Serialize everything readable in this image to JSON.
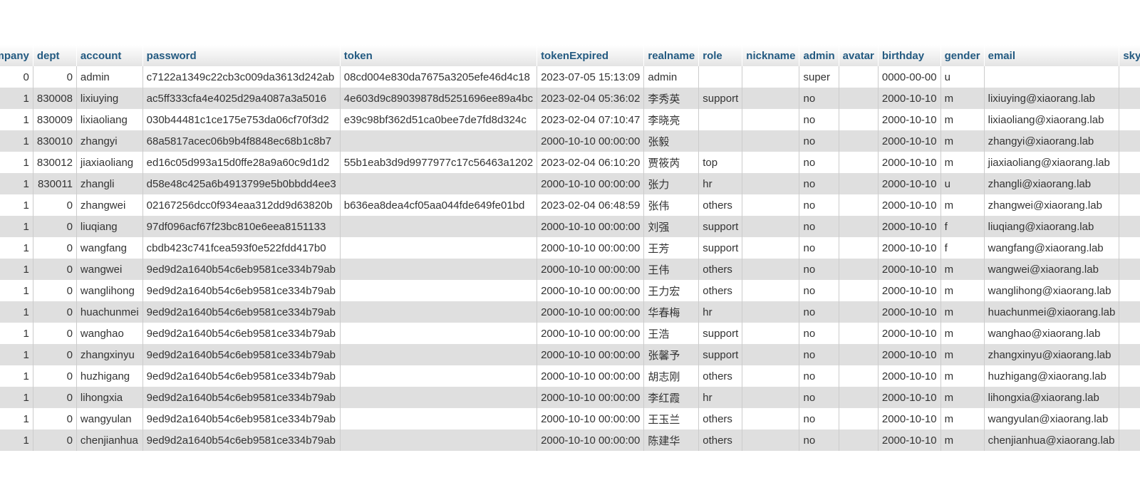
{
  "table": {
    "columns": [
      "company",
      "dept",
      "account",
      "password",
      "token",
      "tokenExpired",
      "realname",
      "role",
      "nickname",
      "admin",
      "avatar",
      "birthday",
      "gender",
      "email",
      "skype"
    ],
    "header_labels": {
      "company": "company",
      "dept": "dept",
      "account": "account",
      "password": "password",
      "token": "token",
      "tokenExpired": "tokenExpired",
      "realname": "realname",
      "role": "role",
      "nickname": "nickname",
      "admin": "admin",
      "avatar": "avatar",
      "birthday": "birthday",
      "gender": "gender",
      "email": "email",
      "skype": "skype"
    },
    "rows": [
      [
        "0",
        "0",
        "admin",
        "c7122a1349c22cb3c009da3613d242ab",
        "08cd004e830da7675a3205efe46d4c18",
        "2023-07-05 15:13:09",
        "admin",
        "",
        "",
        "super",
        "",
        "0000-00-00",
        "u",
        "",
        ""
      ],
      [
        "1",
        "830008",
        "lixiuying",
        "ac5ff333cfa4e4025d29a4087a3a5016",
        "4e603d9c89039878d5251696ee89a4bc",
        "2023-02-04 05:36:02",
        "李秀英",
        "support",
        "",
        "no",
        "",
        "2000-10-10",
        "m",
        "lixiuying@xiaorang.lab",
        ""
      ],
      [
        "1",
        "830009",
        "lixiaoliang",
        "030b44481c1ce175e753da06cf70f3d2",
        "e39c98bf362d51ca0bee7de7fd8d324c",
        "2023-02-04 07:10:47",
        "李晓亮",
        "",
        "",
        "no",
        "",
        "2000-10-10",
        "m",
        "lixiaoliang@xiaorang.lab",
        ""
      ],
      [
        "1",
        "830010",
        "zhangyi",
        "68a5817acec06b9b4f8848ec68b1c8b7",
        "",
        "2000-10-10 00:00:00",
        "张毅",
        "",
        "",
        "no",
        "",
        "2000-10-10",
        "m",
        "zhangyi@xiaorang.lab",
        ""
      ],
      [
        "1",
        "830012",
        "jiaxiaoliang",
        "ed16c05d993a15d0ffe28a9a60c9d1d2",
        "55b1eab3d9d9977977c17c56463a1202",
        "2023-02-04 06:10:20",
        "贾筱芮",
        "top",
        "",
        "no",
        "",
        "2000-10-10",
        "m",
        "jiaxiaoliang@xiaorang.lab",
        ""
      ],
      [
        "1",
        "830011",
        "zhangli",
        "d58e48c425a6b4913799e5b0bbdd4ee3",
        "",
        "2000-10-10 00:00:00",
        "张力",
        "hr",
        "",
        "no",
        "",
        "2000-10-10",
        "u",
        "zhangli@xiaorang.lab",
        ""
      ],
      [
        "1",
        "0",
        "zhangwei",
        "02167256dcc0f934eaa312dd9d63820b",
        "b636ea8dea4cf05aa044fde649fe01bd",
        "2023-02-04 06:48:59",
        "张伟",
        "others",
        "",
        "no",
        "",
        "2000-10-10",
        "m",
        "zhangwei@xiaorang.lab",
        ""
      ],
      [
        "1",
        "0",
        "liuqiang",
        "97df096acf67f23bc810e6eea8151133",
        "",
        "2000-10-10 00:00:00",
        "刘强",
        "support",
        "",
        "no",
        "",
        "2000-10-10",
        "f",
        "liuqiang@xiaorang.lab",
        ""
      ],
      [
        "1",
        "0",
        "wangfang",
        "cbdb423c741fcea593f0e522fdd417b0",
        "",
        "2000-10-10 00:00:00",
        "王芳",
        "support",
        "",
        "no",
        "",
        "2000-10-10",
        "f",
        "wangfang@xiaorang.lab",
        ""
      ],
      [
        "1",
        "0",
        "wangwei",
        "9ed9d2a1640b54c6eb9581ce334b79ab",
        "",
        "2000-10-10 00:00:00",
        "王伟",
        "others",
        "",
        "no",
        "",
        "2000-10-10",
        "m",
        "wangwei@xiaorang.lab",
        ""
      ],
      [
        "1",
        "0",
        "wanglihong",
        "9ed9d2a1640b54c6eb9581ce334b79ab",
        "",
        "2000-10-10 00:00:00",
        "王力宏",
        "others",
        "",
        "no",
        "",
        "2000-10-10",
        "m",
        "wanglihong@xiaorang.lab",
        ""
      ],
      [
        "1",
        "0",
        "huachunmei",
        "9ed9d2a1640b54c6eb9581ce334b79ab",
        "",
        "2000-10-10 00:00:00",
        "华春梅",
        "hr",
        "",
        "no",
        "",
        "2000-10-10",
        "m",
        "huachunmei@xiaorang.lab",
        ""
      ],
      [
        "1",
        "0",
        "wanghao",
        "9ed9d2a1640b54c6eb9581ce334b79ab",
        "",
        "2000-10-10 00:00:00",
        "王浩",
        "support",
        "",
        "no",
        "",
        "2000-10-10",
        "m",
        "wanghao@xiaorang.lab",
        ""
      ],
      [
        "1",
        "0",
        "zhangxinyu",
        "9ed9d2a1640b54c6eb9581ce334b79ab",
        "",
        "2000-10-10 00:00:00",
        "张馨予",
        "support",
        "",
        "no",
        "",
        "2000-10-10",
        "m",
        "zhangxinyu@xiaorang.lab",
        ""
      ],
      [
        "1",
        "0",
        "huzhigang",
        "9ed9d2a1640b54c6eb9581ce334b79ab",
        "",
        "2000-10-10 00:00:00",
        "胡志刚",
        "others",
        "",
        "no",
        "",
        "2000-10-10",
        "m",
        "huzhigang@xiaorang.lab",
        ""
      ],
      [
        "1",
        "0",
        "lihongxia",
        "9ed9d2a1640b54c6eb9581ce334b79ab",
        "",
        "2000-10-10 00:00:00",
        "李红霞",
        "hr",
        "",
        "no",
        "",
        "2000-10-10",
        "m",
        "lihongxia@xiaorang.lab",
        ""
      ],
      [
        "1",
        "0",
        "wangyulan",
        "9ed9d2a1640b54c6eb9581ce334b79ab",
        "",
        "2000-10-10 00:00:00",
        "王玉兰",
        "others",
        "",
        "no",
        "",
        "2000-10-10",
        "m",
        "wangyulan@xiaorang.lab",
        ""
      ],
      [
        "1",
        "0",
        "chenjianhua",
        "9ed9d2a1640b54c6eb9581ce334b79ab",
        "",
        "2000-10-10 00:00:00",
        "陈建华",
        "others",
        "",
        "no",
        "",
        "2000-10-10",
        "m",
        "chenjianhua@xiaorang.lab",
        ""
      ]
    ]
  },
  "colors": {
    "header_text": "#235a81",
    "row_alt": "#dfdfdf",
    "row": "#ffffff",
    "border": "#cccccc"
  }
}
